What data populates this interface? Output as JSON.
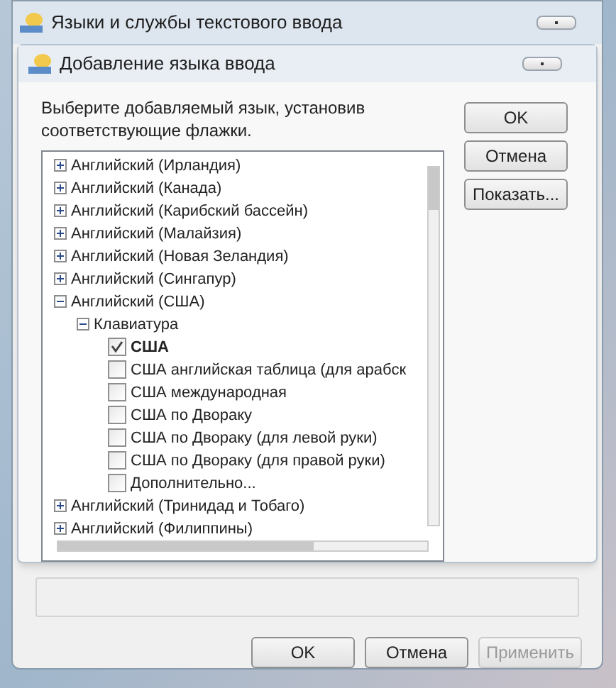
{
  "window": {
    "title": "Языки и службы текстового ввода"
  },
  "dialog": {
    "title": "Добавление языка ввода",
    "instructions": "Выберите добавляемый язык, установив соответствующие флажки.",
    "tree": [
      {
        "label": "Английский (Ирландия)",
        "expanded": false
      },
      {
        "label": "Английский (Канада)",
        "expanded": false
      },
      {
        "label": "Английский (Карибский бассейн)",
        "expanded": false
      },
      {
        "label": "Английский (Малайзия)",
        "expanded": false
      },
      {
        "label": "Английский (Новая Зеландия)",
        "expanded": false
      },
      {
        "label": "Английский (Сингапур)",
        "expanded": false
      },
      {
        "label": "Английский (США)",
        "expanded": true,
        "children": [
          {
            "label": "Клавиатура",
            "expanded": true,
            "children": [
              {
                "label": "США",
                "checked": true
              },
              {
                "label": "США английская таблица (для арабск",
                "checked": false
              },
              {
                "label": "США международная",
                "checked": false
              },
              {
                "label": "США по Двораку",
                "checked": false
              },
              {
                "label": "США по Двораку (для левой руки)",
                "checked": false
              },
              {
                "label": "США по Двораку (для правой руки)",
                "checked": false
              },
              {
                "label": "Дополнительно...",
                "checked": false
              }
            ]
          }
        ]
      },
      {
        "label": "Английский (Тринидад и Тобаго)",
        "expanded": false
      },
      {
        "label": "Английский (Филиппины)",
        "expanded": false
      }
    ],
    "buttons": [
      {
        "label": "OK",
        "disabled": false
      },
      {
        "label": "Отмена",
        "disabled": false
      },
      {
        "label": "Показать...",
        "disabled": false
      }
    ]
  },
  "buttons": [
    {
      "label": "OK",
      "disabled": false
    },
    {
      "label": "Отмена",
      "disabled": false
    },
    {
      "label": "Применить",
      "disabled": true
    }
  ]
}
